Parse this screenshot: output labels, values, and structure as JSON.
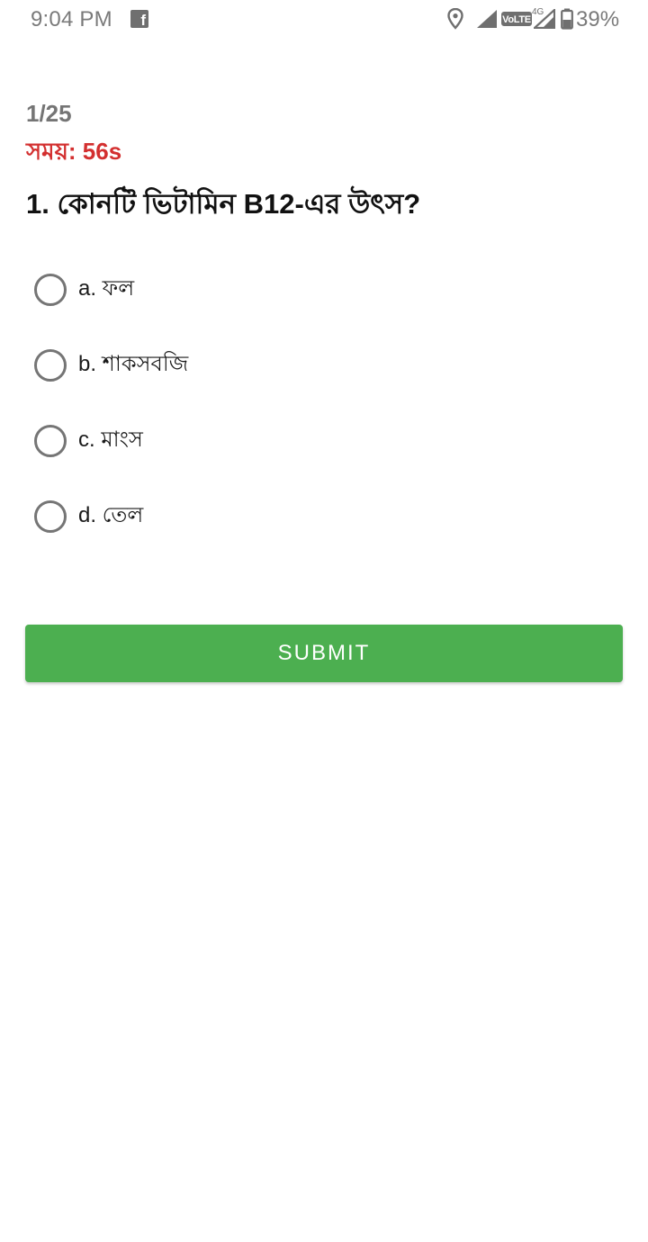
{
  "status_bar": {
    "time": "9:04 PM",
    "app_icon": "facebook-icon",
    "volte_label": "VoLTE",
    "network_type": "4G",
    "battery": "39%"
  },
  "quiz": {
    "progress": "1/25",
    "timer": "সময়: 56s",
    "question": "1. কোনটি ভিটামিন B12-এর উৎস?",
    "options": [
      {
        "label": "a. ফল",
        "selected": false
      },
      {
        "label": "b. শাকসবজি",
        "selected": false
      },
      {
        "label": "c. মাংস",
        "selected": false
      },
      {
        "label": "d. তেল",
        "selected": false
      }
    ],
    "submit_label": "SUBMIT"
  },
  "colors": {
    "timer": "#d32f2f",
    "submit_button": "#4caf50",
    "muted_text": "#757575"
  }
}
